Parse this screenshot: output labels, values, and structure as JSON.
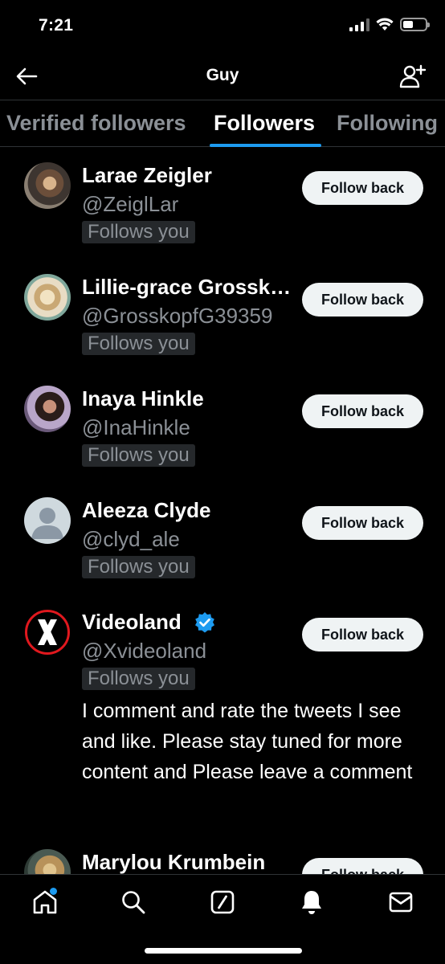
{
  "status_bar": {
    "time": "7:21",
    "battery_level": 0.45
  },
  "header": {
    "title": "Guy"
  },
  "tabs": [
    {
      "label": "Verified followers",
      "active": false
    },
    {
      "label": "Followers",
      "active": true
    },
    {
      "label": "Following",
      "active": false
    }
  ],
  "users": [
    {
      "name": "Larae Zeigler",
      "handle": "@ZeiglLar",
      "badge": "Follows you",
      "button": "Follow back"
    },
    {
      "name": "Lillie-grace Grosskopf",
      "handle": "@GrosskopfG39359",
      "badge": "Follows you",
      "button": "Follow back"
    },
    {
      "name": "Inaya Hinkle",
      "handle": "@InaHinkle",
      "badge": "Follows you",
      "button": "Follow back"
    },
    {
      "name": "Aleeza Clyde",
      "handle": "@clyd_ale",
      "badge": "Follows you",
      "button": "Follow back"
    },
    {
      "name": "Videoland",
      "handle": "@Xvideoland",
      "badge": "Follows you",
      "button": "Follow back",
      "verified": true,
      "bio": "I comment and rate the tweets I see and like. Please stay tuned for more content and Please leave a comment"
    },
    {
      "name": "Marylou Krumbein",
      "handle": "",
      "badge": "",
      "button": "Follow back"
    }
  ],
  "colors": {
    "accent": "#1d9bf0",
    "background": "#000000",
    "secondary_text": "#8b9096",
    "button_bg": "#eff3f4"
  },
  "icons": {
    "back": "arrow-left-icon",
    "add_user": "add-user-icon",
    "nav": [
      "home-icon",
      "search-icon",
      "compose-icon",
      "notifications-icon",
      "messages-icon"
    ]
  }
}
